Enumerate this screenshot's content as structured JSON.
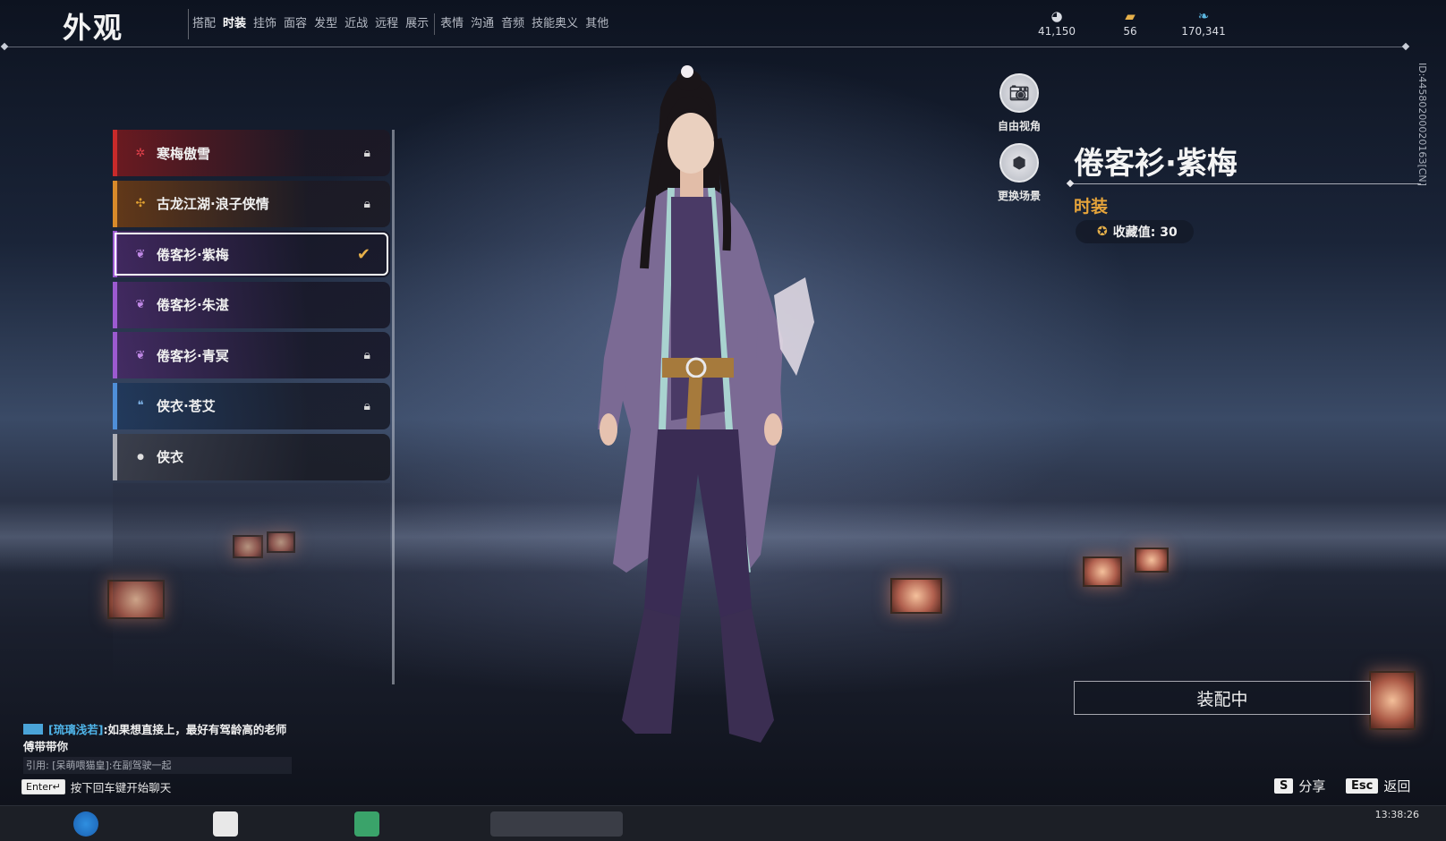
{
  "header": {
    "title": "外观",
    "tabs": [
      "搭配",
      "时装",
      "挂饰",
      "面容",
      "发型",
      "近战",
      "远程",
      "展示",
      "表情",
      "沟通",
      "音频",
      "技能奥义",
      "其他"
    ],
    "active_tab": "时装"
  },
  "currencies": [
    {
      "icon": "coin-icon",
      "value": "41,150"
    },
    {
      "icon": "ticket-icon",
      "value": "56"
    },
    {
      "icon": "feather-icon",
      "value": "170,341"
    }
  ],
  "outfits": [
    {
      "name": "寒梅傲雪",
      "gem": "✲",
      "gem_color": "#e0404a",
      "rarity": "red",
      "state": "locked"
    },
    {
      "name": "古龙江湖·浪子侠情",
      "gem": "✣",
      "gem_color": "#e0a030",
      "rarity": "orange",
      "state": "locked"
    },
    {
      "name": "倦客衫·紫梅",
      "gem": "❦",
      "gem_color": "#c28ae8",
      "rarity": "purple",
      "state": "equipped"
    },
    {
      "name": "倦客衫·朱湛",
      "gem": "❦",
      "gem_color": "#c28ae8",
      "rarity": "purple",
      "state": "owned"
    },
    {
      "name": "倦客衫·青冥",
      "gem": "❦",
      "gem_color": "#c28ae8",
      "rarity": "purple",
      "state": "locked"
    },
    {
      "name": "侠衣·苍艾",
      "gem": "❝",
      "gem_color": "#7fb4e8",
      "rarity": "blue",
      "state": "locked"
    },
    {
      "name": "侠衣",
      "gem": "●",
      "gem_color": "#e0e0e0",
      "rarity": "gray",
      "state": "owned"
    }
  ],
  "tools": {
    "free_view": "自由视角",
    "change_scene": "更换场景"
  },
  "detail": {
    "name": "倦客衫·紫梅",
    "type": "时装",
    "collection": "收藏值: 30",
    "player_id": "ID:4458020002016З[CN]",
    "equip_button": "装配中"
  },
  "chat": {
    "speaker": "[琉璃浅若]",
    "message": ":如果想直接上，最好有驾龄高的老师傅带带你",
    "quote": "引用: [呆萌喂猫皇]:在副驾驶一起",
    "enter_key": "Enter↵",
    "hint": "按下回车键开始聊天"
  },
  "footer": {
    "share_key": "S",
    "share_label": "分享",
    "back_key": "Esc",
    "back_label": "返回"
  },
  "taskbar": {
    "clock": "13:38:26"
  },
  "colors": {
    "accent_red": "#d83020",
    "gold": "#e6a43a",
    "chat_name": "#4fb4e8"
  }
}
